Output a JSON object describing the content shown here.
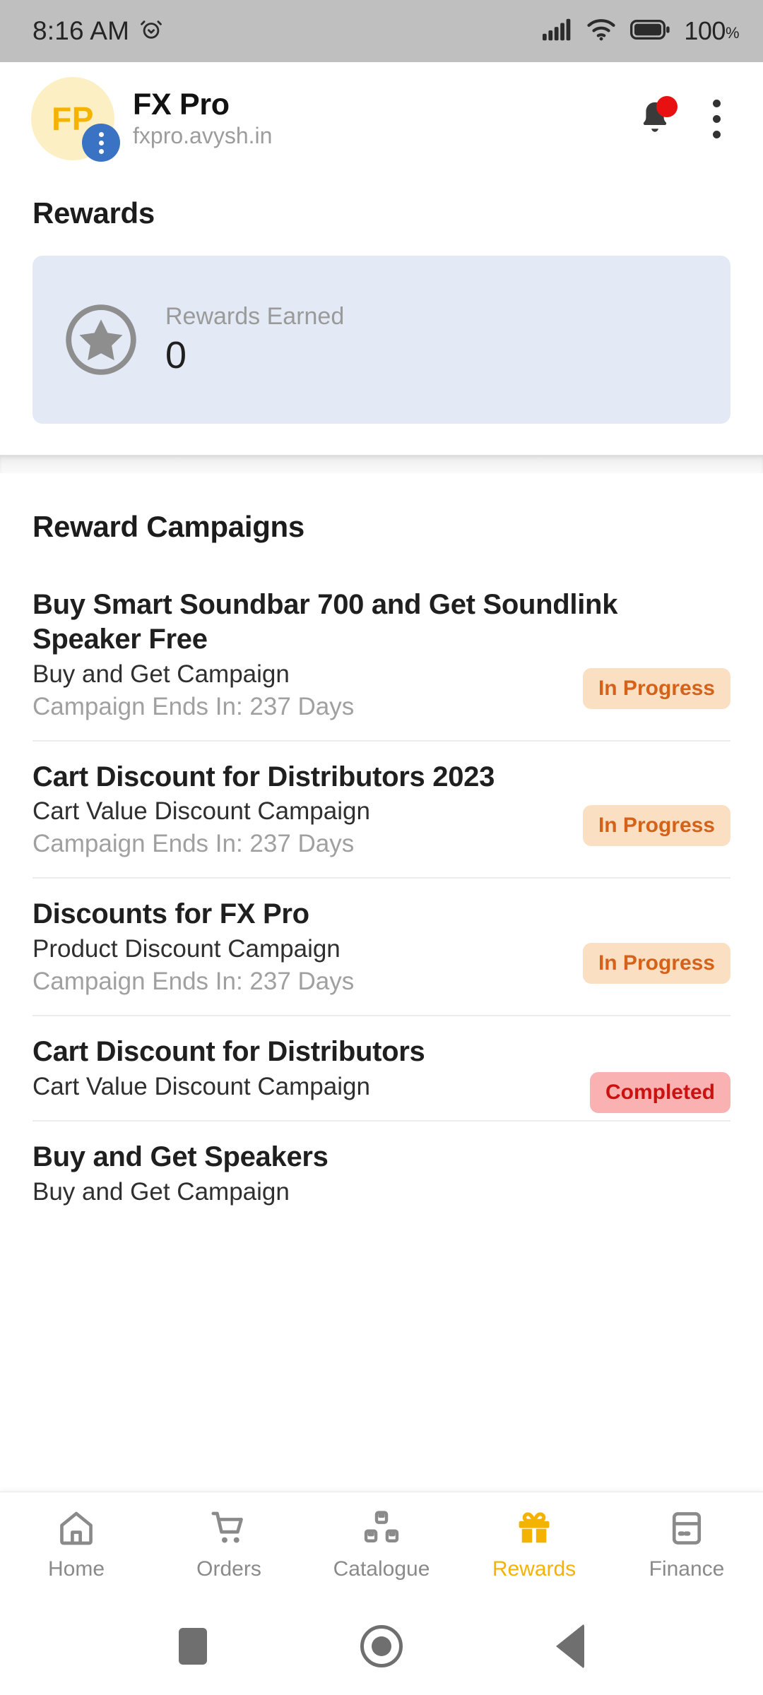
{
  "status_bar": {
    "time": "8:16 AM",
    "alarm_icon": "alarm-icon",
    "signal_icon": "signal-bars-icon",
    "wifi_icon": "wifi-icon",
    "battery_icon": "battery-full-icon",
    "battery_percent": "100",
    "percent_symbol": "%",
    "background_color": "#bfbfbf"
  },
  "app_bar": {
    "avatar_initials": "FP",
    "avatar_bg_color": "#fcefc3",
    "avatar_text_color": "#f5b301",
    "avatar_badge_icon": "more-vertical-icon",
    "avatar_badge_color": "#3b73c4",
    "title": "FX Pro",
    "subtitle": "fxpro.avysh.in",
    "notifications_icon": "bell-icon",
    "notification_dot_color": "#e81010",
    "overflow_icon": "kebab-menu-icon"
  },
  "rewards_section": {
    "heading": "Rewards",
    "card": {
      "icon": "star-circle-icon",
      "label": "Rewards Earned",
      "value": "0",
      "background_color": "#e3e9f5",
      "icon_color": "#8e8e8e"
    }
  },
  "campaigns_section": {
    "heading": "Reward Campaigns",
    "ends_prefix": "Campaign Ends In:",
    "items": [
      {
        "title": "Buy Smart Soundbar 700 and Get Soundlink Speaker Free",
        "type": "Buy and Get Campaign",
        "ends_in": "Campaign Ends In: 237 Days",
        "status": "In Progress",
        "status_kind": "inprogress"
      },
      {
        "title": "Cart Discount for Distributors 2023",
        "type": "Cart Value Discount Campaign",
        "ends_in": "Campaign Ends In: 237 Days",
        "status": "In Progress",
        "status_kind": "inprogress"
      },
      {
        "title": "Discounts for FX Pro",
        "type": "Product Discount Campaign",
        "ends_in": "Campaign Ends In: 237 Days",
        "status": "In Progress",
        "status_kind": "inprogress"
      },
      {
        "title": "Cart Discount for Distributors",
        "type": "Cart Value Discount Campaign",
        "ends_in": "",
        "status": "Completed",
        "status_kind": "completed"
      },
      {
        "title": "Buy and Get Speakers",
        "type": "Buy and Get Campaign",
        "ends_in": "",
        "status": "",
        "status_kind": ""
      }
    ],
    "status_colors": {
      "in_progress_bg": "#fadfc2",
      "in_progress_text": "#d4621a",
      "completed_bg": "#fab1b1",
      "completed_text": "#cc1111"
    }
  },
  "bottom_nav": {
    "active_color": "#f5b301",
    "inactive_color": "#8a8a8a",
    "items": [
      {
        "label": "Home",
        "icon": "home-icon",
        "active": false
      },
      {
        "label": "Orders",
        "icon": "shopping-cart-icon",
        "active": false
      },
      {
        "label": "Catalogue",
        "icon": "boxes-icon",
        "active": false
      },
      {
        "label": "Rewards",
        "icon": "gift-icon",
        "active": true
      },
      {
        "label": "Finance",
        "icon": "credit-card-icon",
        "active": false
      }
    ]
  },
  "android_nav": {
    "recents_icon": "square-recents-icon",
    "home_icon": "circle-home-icon",
    "back_icon": "triangle-back-icon"
  }
}
